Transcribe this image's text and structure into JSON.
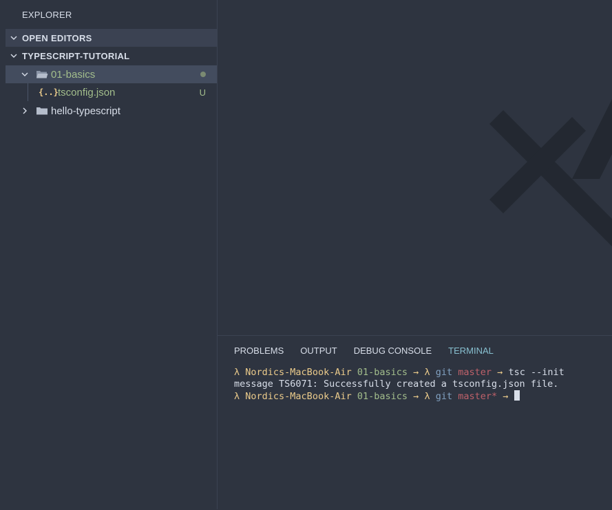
{
  "sidebar": {
    "title": "EXPLORER",
    "sections": [
      {
        "label": "OPEN EDITORS"
      },
      {
        "label": "TYPESCRIPT-TUTORIAL"
      }
    ],
    "tree": [
      {
        "label": "01-basics",
        "status": "modified-dot"
      },
      {
        "label": "tsconfig.json",
        "icon_text": "{..}",
        "badge": "U"
      },
      {
        "label": "hello-typescript"
      }
    ]
  },
  "panel": {
    "tabs": [
      "PROBLEMS",
      "OUTPUT",
      "DEBUG CONSOLE",
      "TERMINAL"
    ],
    "active_tab": "TERMINAL",
    "terminal": {
      "line1": {
        "lambda": "λ",
        "host": "Nordics-MacBook-Air",
        "dir": "01-basics",
        "arrow1": "→",
        "lambda2": "λ",
        "git": "git",
        "branch": "master",
        "arrow2": "→",
        "command": "tsc --init"
      },
      "line2": "message TS6071: Successfully created a tsconfig.json file.",
      "line3": {
        "lambda": "λ",
        "host": "Nordics-MacBook-Air",
        "dir": "01-basics",
        "arrow1": "→",
        "lambda2": "λ",
        "git": "git",
        "branch": "master*",
        "arrow2": "→"
      }
    }
  },
  "colors": {
    "background": "#2e3440",
    "accent": "#88c0d0",
    "git_added": "#a3be8c",
    "prompt_yellow": "#ebcb8b",
    "branch_red": "#bf616a"
  }
}
